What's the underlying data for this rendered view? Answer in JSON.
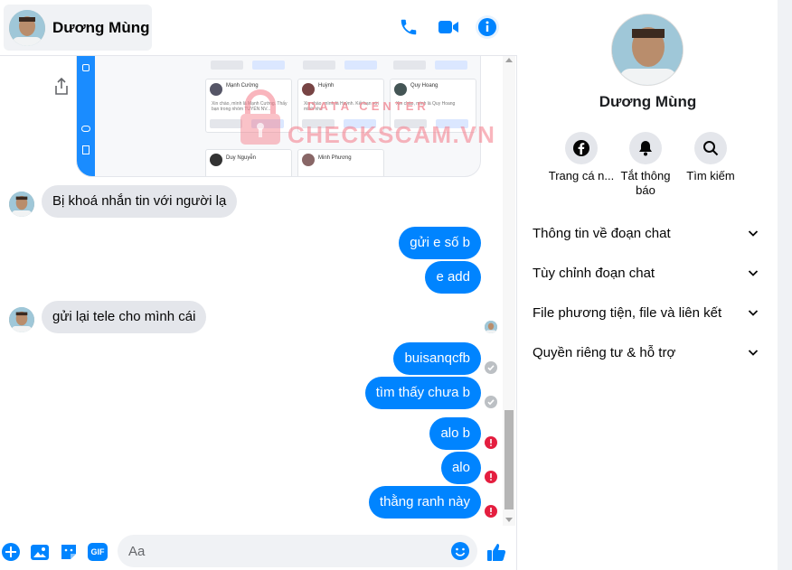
{
  "header": {
    "contact_name": "Dương Mùng",
    "call_icon": "phone-icon",
    "video_icon": "video-camera-icon",
    "info_icon": "info-icon"
  },
  "screenshot_preview": {
    "cards": [
      {
        "name": "Mạnh Cường",
        "text": "Xin chào, mình là Mạnh Cường. Thấy bạn trong nhóm TUYỂN NV...",
        "decline": "Từ chối",
        "accept": "Đồng ý"
      },
      {
        "name": "Huỳnh",
        "text": "Xin chào, mình là Huỳnh. Kết bạn với mình nhé",
        "decline": "Từ chối",
        "accept": "Đồng ý"
      },
      {
        "name": "Quy Hoang",
        "text": "Xin chào, mình là Quy Hoang",
        "decline": "Từ chối",
        "accept": "Đồng ý"
      },
      {
        "name": "Duy Nguyễn"
      },
      {
        "name": "Minh Phương"
      }
    ],
    "top_row_buttons": {
      "decline": "Từ chối",
      "accept": "Đồng ý"
    }
  },
  "watermark": {
    "top": "DATA CENTER",
    "main": "CHECKSCAM.VN"
  },
  "messages": [
    {
      "direction": "in",
      "text": "Bị khoá nhắn tin với người lạ"
    },
    {
      "direction": "out",
      "text": "gửi e số b"
    },
    {
      "direction": "out",
      "text": "e add"
    },
    {
      "direction": "in",
      "text": "gửi lại tele cho mình cái"
    },
    {
      "direction": "out",
      "text": "buisanqcfb",
      "status": "sent"
    },
    {
      "direction": "out",
      "text": "tìm thấy chưa b",
      "status": "sent"
    },
    {
      "direction": "out",
      "text": "alo b",
      "status": "failed"
    },
    {
      "direction": "out",
      "text": "alo",
      "status": "failed"
    },
    {
      "direction": "out",
      "text": "thằng ranh này",
      "status": "failed"
    }
  ],
  "composer": {
    "placeholder": "Aa",
    "icons": [
      "plus-circle-icon",
      "photo-icon",
      "sticker-icon",
      "gif-icon",
      "emoji-icon",
      "thumbs-up-icon"
    ],
    "gif_label": "GIF"
  },
  "info_panel": {
    "name": "Dương Mùng",
    "actions": [
      {
        "label": "Trang cá n...",
        "icon": "facebook-icon"
      },
      {
        "label": "Tắt thông báo",
        "icon": "bell-icon"
      },
      {
        "label": "Tìm kiếm",
        "icon": "search-icon"
      }
    ],
    "sections": [
      "Thông tin về đoạn chat",
      "Tùy chỉnh đoạn chat",
      "File phương tiện, file và liên kết",
      "Quyền riêng tư & hỗ trợ"
    ]
  },
  "colors": {
    "accent": "#0084ff",
    "incoming_bubble": "#e4e6eb",
    "failed": "#e41e3f",
    "sent": "#bcc0c4"
  }
}
